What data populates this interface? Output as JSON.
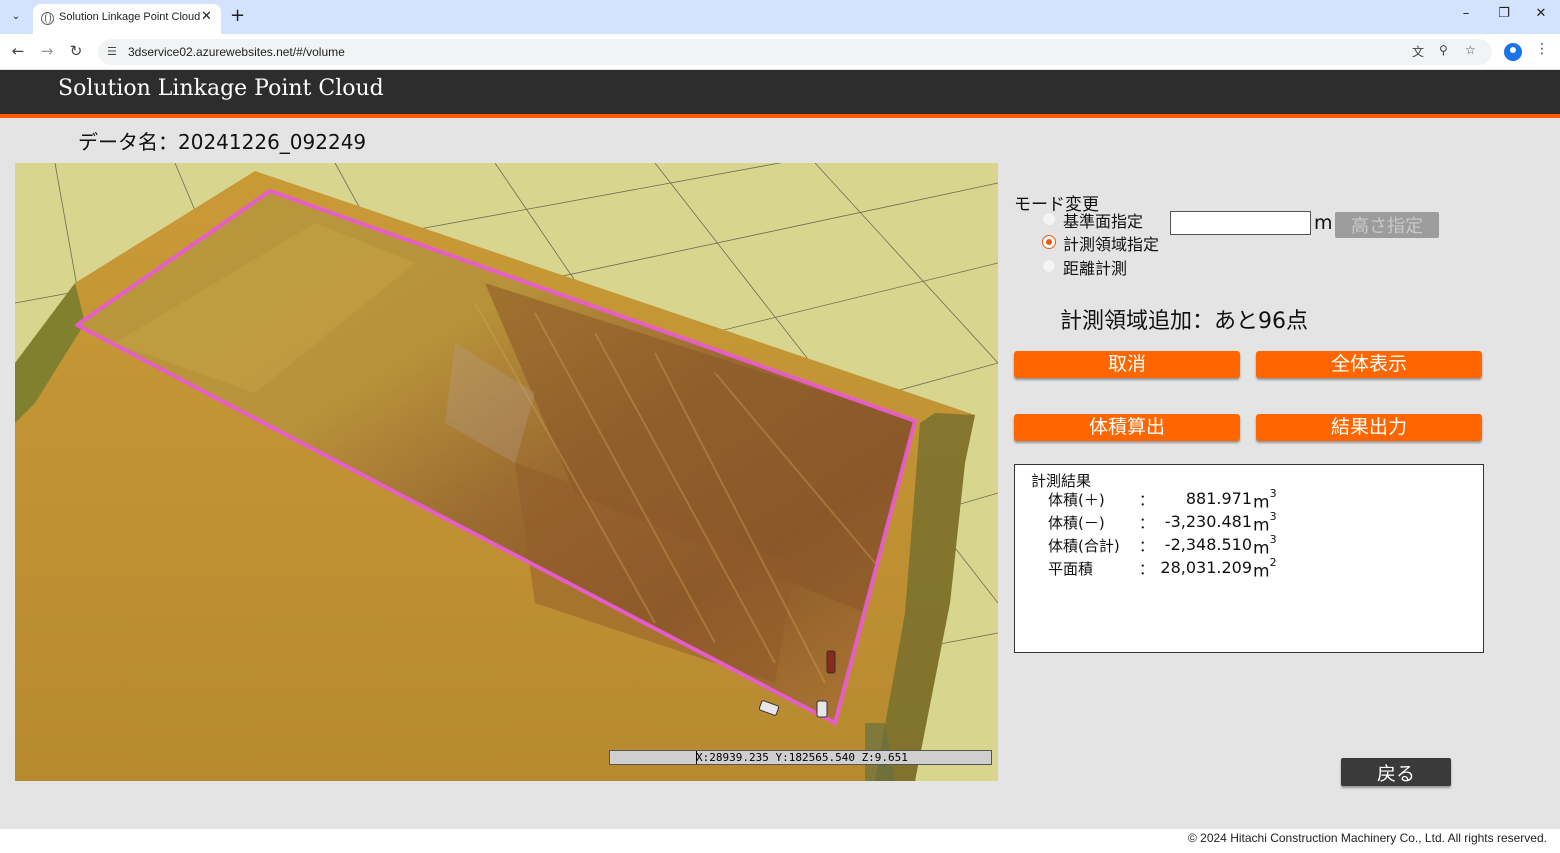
{
  "browser": {
    "tab_title": "Solution Linkage Point Cloud",
    "url": "3dservice02.azurewebsites.net/#/volume",
    "icons": [
      "tab-list-icon",
      "globe-icon",
      "close-icon",
      "plus-icon",
      "minimize-icon",
      "restore-icon",
      "back-arrow-icon",
      "forward-arrow-icon",
      "reload-icon",
      "site-info-icon",
      "translate-icon",
      "zoom-icon",
      "star-icon",
      "profile-icon",
      "kebab-menu-icon"
    ]
  },
  "header": {
    "title": "Solution Linkage Point Cloud",
    "data_name_label": "データ名：",
    "data_name_value": "20241226_092249",
    "accent_color": "#ff5a00"
  },
  "viewer": {
    "coordinate_readout": "X:28939.235 Y:182565.540 Z:9.651",
    "ground_color": "#d8d68e",
    "boundary_color": "#e85cd0"
  },
  "mode": {
    "title": "モード変更",
    "options": [
      {
        "label": "基準面指定",
        "selected": false
      },
      {
        "label": "計測領域指定",
        "selected": true
      },
      {
        "label": "距離計測",
        "selected": false
      }
    ],
    "height_value": "",
    "height_unit": "m",
    "height_button": "高さ指定"
  },
  "status": {
    "remaining_text": "計測領域追加：あと96点"
  },
  "buttons": {
    "cancel": "取消",
    "show_all": "全体表示",
    "compute_volume": "体積算出",
    "export_result": "結果出力",
    "back": "戻る",
    "primary_color": "#ff6600"
  },
  "results": {
    "title": "計測結果",
    "rows": [
      {
        "label": "体積(＋)",
        "colon": "：",
        "value": "881.971",
        "unit": "m",
        "exp": "3"
      },
      {
        "label": "体積(－)",
        "colon": "：",
        "value": "-3,230.481",
        "unit": "m",
        "exp": "3"
      },
      {
        "label": "体積(合計)",
        "colon": "：",
        "value": "-2,348.510",
        "unit": "m",
        "exp": "3"
      },
      {
        "label": "平面積",
        "colon": "：",
        "value": "28,031.209",
        "unit": "m",
        "exp": "2"
      }
    ]
  },
  "footer": {
    "copyright": "© 2024 Hitachi Construction Machinery Co., Ltd. All rights reserved."
  }
}
